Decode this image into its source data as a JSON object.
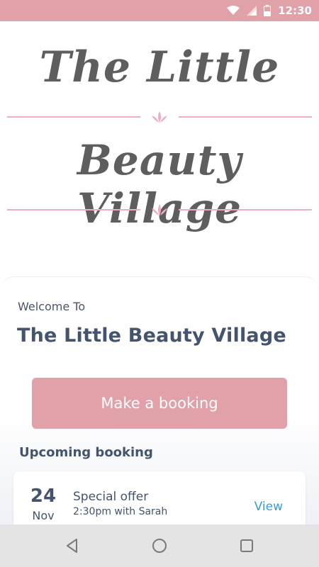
{
  "status_bar": {
    "time": "12:30",
    "icons": [
      "wifi-icon",
      "signal-icon",
      "battery-icon"
    ],
    "background": "#e0a1a9"
  },
  "logo": {
    "line1": "The Little",
    "line2": "Beauty Village",
    "accent_color": "#efaec0"
  },
  "welcome": {
    "label": "Welcome To",
    "title": "The Little Beauty Village"
  },
  "booking_button": {
    "label": "Make a booking",
    "color": "#e0a1a9"
  },
  "upcoming": {
    "heading": "Upcoming booking",
    "items": [
      {
        "day": "24",
        "month": "Nov",
        "title": "Special offer",
        "subtitle": "2:30pm with Sarah",
        "action": "View"
      }
    ]
  },
  "nav_bar": {
    "buttons": [
      "back-icon",
      "home-icon",
      "recents-icon"
    ]
  }
}
